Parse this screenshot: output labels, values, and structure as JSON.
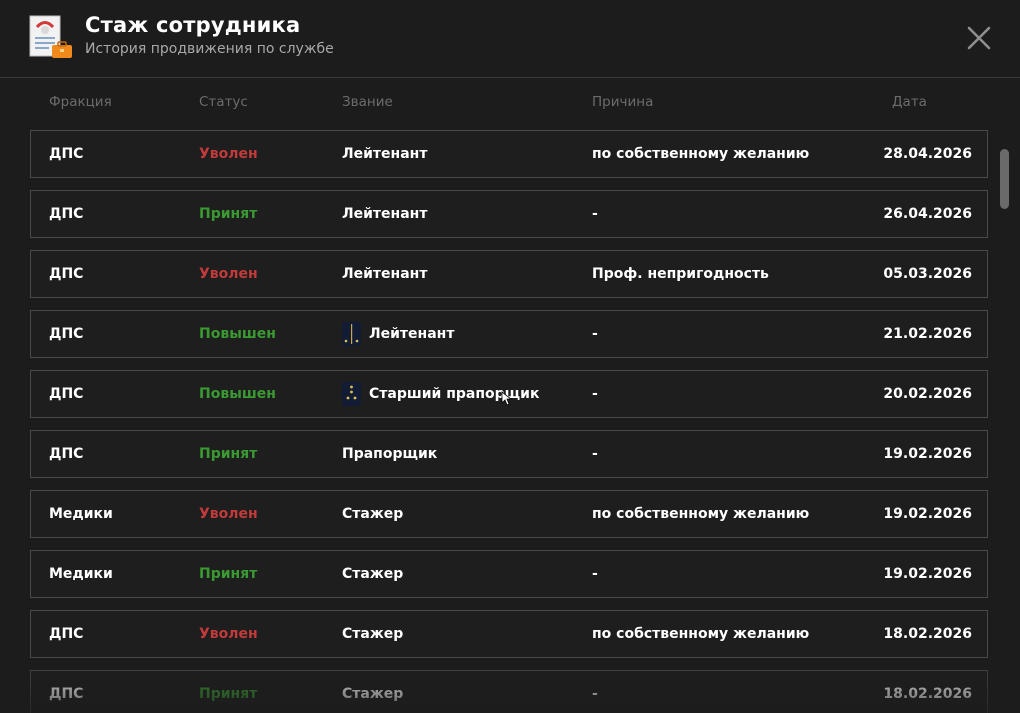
{
  "header": {
    "title": "Стаж сотрудника",
    "subtitle": "История продвижения по службе"
  },
  "columns": {
    "faction": "Фракция",
    "status": "Статус",
    "rank": "Звание",
    "reason": "Причина",
    "date": "Дата"
  },
  "colors": {
    "background": "#1c1c1c",
    "dismissed": "#c23a3a",
    "hired": "#3a9a32",
    "header_text": "#6b6b6b"
  },
  "rows": [
    {
      "faction": "ДПС",
      "status": "Уволен",
      "status_type": "red",
      "rank": "Лейтенант",
      "rank_icon": "none",
      "reason": "по собственному желанию",
      "date": "28.04.2026"
    },
    {
      "faction": "ДПС",
      "status": "Принят",
      "status_type": "green",
      "rank": "Лейтенант",
      "rank_icon": "none",
      "reason": "-",
      "date": "26.04.2026"
    },
    {
      "faction": "ДПС",
      "status": "Уволен",
      "status_type": "red",
      "rank": "Лейтенант",
      "rank_icon": "none",
      "reason": "Проф. непригодность",
      "date": "05.03.2026"
    },
    {
      "faction": "ДПС",
      "status": "Повышен",
      "status_type": "green",
      "rank": "Лейтенант",
      "rank_icon": "lieutenant-shoulder-board-icon",
      "reason": "-",
      "date": "21.02.2026"
    },
    {
      "faction": "ДПС",
      "status": "Повышен",
      "status_type": "green",
      "rank": "Старший прапорщик",
      "rank_icon": "senior-warrant-officer-shoulder-board-icon",
      "reason": "-",
      "date": "20.02.2026"
    },
    {
      "faction": "ДПС",
      "status": "Принят",
      "status_type": "green",
      "rank": "Прапорщик",
      "rank_icon": "none",
      "reason": "-",
      "date": "19.02.2026"
    },
    {
      "faction": "Медики",
      "status": "Уволен",
      "status_type": "red",
      "rank": "Стажер",
      "rank_icon": "none",
      "reason": "по собственному желанию",
      "date": "19.02.2026"
    },
    {
      "faction": "Медики",
      "status": "Принят",
      "status_type": "green",
      "rank": "Стажер",
      "rank_icon": "none",
      "reason": "-",
      "date": "19.02.2026"
    },
    {
      "faction": "ДПС",
      "status": "Уволен",
      "status_type": "red",
      "rank": "Стажер",
      "rank_icon": "none",
      "reason": "по собственному желанию",
      "date": "18.02.2026"
    },
    {
      "faction": "ДПС",
      "status": "Принят",
      "status_type": "green",
      "rank": "Стажер",
      "rank_icon": "none",
      "reason": "-",
      "date": "18.02.2026"
    }
  ]
}
